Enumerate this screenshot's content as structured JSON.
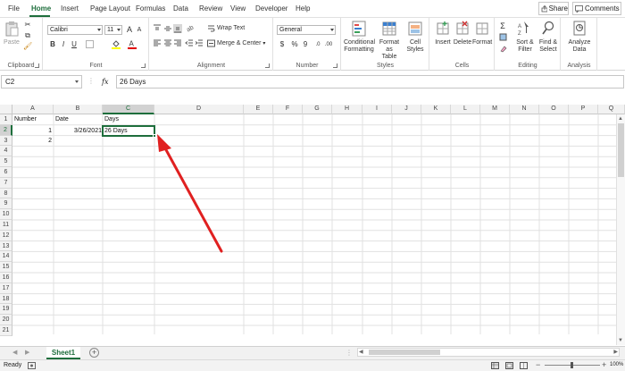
{
  "ribbon_tabs": [
    "File",
    "Home",
    "Insert",
    "Page Layout",
    "Formulas",
    "Data",
    "Review",
    "View",
    "Developer",
    "Help"
  ],
  "active_tab": "Home",
  "share_label": "Share",
  "comments_label": "Comments",
  "ribbon": {
    "clipboard": {
      "paste": "Paste",
      "label": "Clipboard"
    },
    "font": {
      "font_name": "Calibri",
      "font_size": "11",
      "label": "Font",
      "bold": "B",
      "italic": "I",
      "underline": "U"
    },
    "alignment": {
      "wrap_text": "Wrap Text",
      "merge_center": "Merge & Center",
      "label": "Alignment"
    },
    "number": {
      "format": "General",
      "currency": "$",
      "percent": "%",
      "comma": "9",
      "label": "Number"
    },
    "styles": {
      "conditional_formatting": [
        "Conditional",
        "Formatting"
      ],
      "format_as_table": [
        "Format as",
        "Table"
      ],
      "cell_styles": [
        "Cell",
        "Styles"
      ],
      "label": "Styles"
    },
    "cells": {
      "insert": "Insert",
      "delete": "Delete",
      "format": "Format",
      "label": "Cells"
    },
    "editing": {
      "sort_filter": [
        "Sort &",
        "Filter"
      ],
      "find_select": [
        "Find &",
        "Select"
      ],
      "label": "Editing"
    },
    "analysis": {
      "analyze_data": [
        "Analyze",
        "Data"
      ],
      "label": "Analysis"
    }
  },
  "formula_bar": {
    "name_box": "C2",
    "fx": "fx",
    "content": "26 Days"
  },
  "columns": [
    "A",
    "B",
    "C",
    "D",
    "E",
    "F",
    "G",
    "H",
    "I",
    "J",
    "K",
    "L",
    "M",
    "N",
    "O",
    "P",
    "Q"
  ],
  "rows": [
    "1",
    "2",
    "3",
    "4",
    "5",
    "6",
    "7",
    "8",
    "9",
    "10",
    "11",
    "12",
    "13",
    "14",
    "15",
    "16",
    "17",
    "18",
    "19",
    "20",
    "21",
    "22",
    "23"
  ],
  "cells": {
    "A1": "Number",
    "B1": "Date",
    "C1": "Days",
    "A2": "1",
    "B2": "3/26/2021",
    "C2": "26 Days",
    "A3": "2"
  },
  "sheet_tab": "Sheet1",
  "status": {
    "ready": "Ready",
    "zoom": "100%"
  },
  "colors": {
    "accent": "#1e6e3c",
    "arrow": "#e02020"
  }
}
